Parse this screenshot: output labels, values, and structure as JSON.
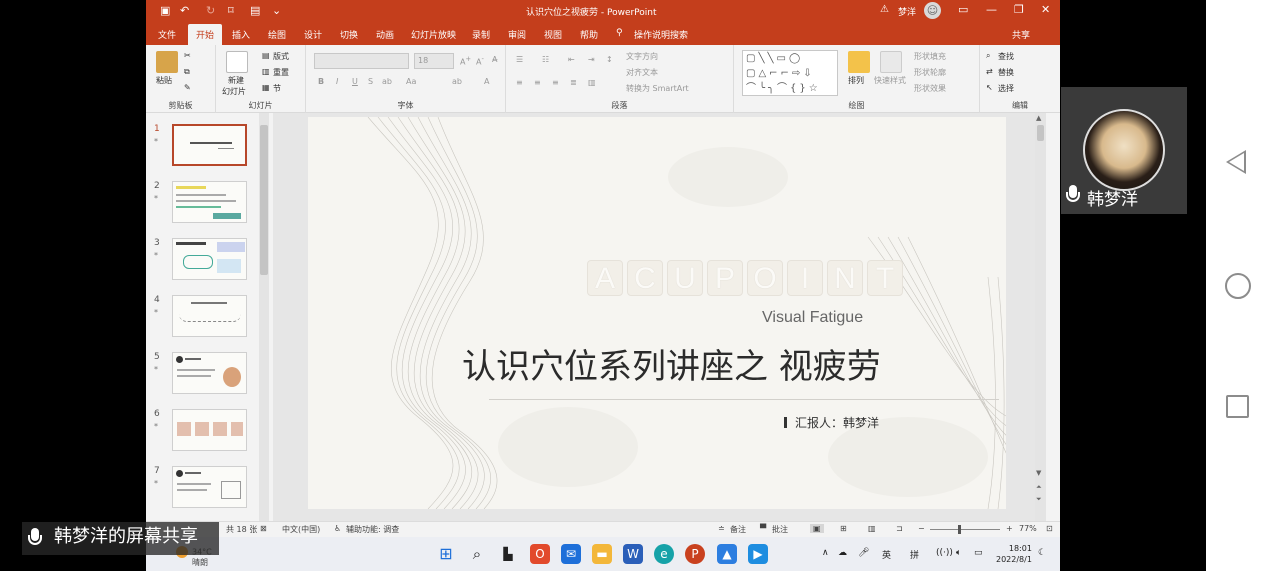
{
  "window": {
    "title": "认识穴位之视疲劳 - PowerPoint",
    "user": "梦洋",
    "share": "共享"
  },
  "ribbon_tabs": [
    "文件",
    "开始",
    "插入",
    "绘图",
    "设计",
    "切换",
    "动画",
    "幻灯片放映",
    "录制",
    "审阅",
    "视图",
    "帮助"
  ],
  "active_tab": "开始",
  "tell_me": "操作说明搜索",
  "ribbon": {
    "clipboard": {
      "paste": "粘贴",
      "group": "剪贴板"
    },
    "slides": {
      "new_slide_1": "新建",
      "new_slide_2": "幻灯片",
      "layout": "版式",
      "reset": "重置",
      "section": "节",
      "group": "幻灯片"
    },
    "font": {
      "size": "18",
      "group": "字体"
    },
    "paragraph": {
      "text_direction": "文字方向",
      "align_text": "对齐文本",
      "smartart": "转换为 SmartArt",
      "group": "段落"
    },
    "drawing": {
      "arrange": "排列",
      "quick_styles": "快速样式",
      "shape_fill": "形状填充",
      "shape_outline": "形状轮廓",
      "shape_effects": "形状效果",
      "group": "绘图"
    },
    "editing": {
      "find": "查找",
      "replace": "替换",
      "select": "选择",
      "group": "编辑"
    }
  },
  "slide_thumbnails": [
    {
      "num": "1"
    },
    {
      "num": "2"
    },
    {
      "num": "3"
    },
    {
      "num": "4"
    },
    {
      "num": "5"
    },
    {
      "num": "6"
    },
    {
      "num": "7"
    }
  ],
  "slide": {
    "decor_word": [
      "A",
      "C",
      "U",
      "P",
      "O",
      "I",
      "N",
      "T"
    ],
    "subtitle_en": "Visual Fatigue",
    "title": "认识穴位系列讲座之 视疲劳",
    "reporter": "汇报人：韩梦洋"
  },
  "status": {
    "slide_count": "共 18 张",
    "language": "中文(中国)",
    "accessibility": "辅助功能: 调查",
    "notes": "备注",
    "comments": "批注",
    "zoom": "77%"
  },
  "taskbar": {
    "weather_temp": "34°C",
    "weather_desc": "晴朗",
    "ime_lang": "英",
    "ime_mode": "拼",
    "time": "18:01",
    "date": "2022/8/1"
  },
  "overlay": {
    "screen_share_label": "韩梦洋的屏幕共享",
    "participant_name": "韩梦洋"
  }
}
